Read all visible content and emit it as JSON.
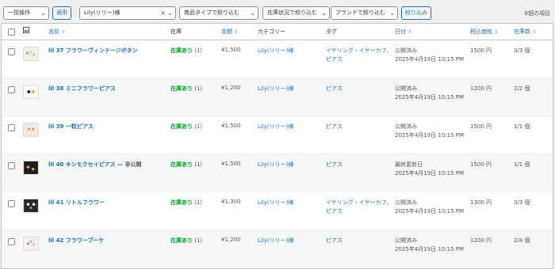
{
  "filters": {
    "bulk": "一括操作",
    "apply": "適用",
    "category": "Lily(リリー)様",
    "type": "商品タイプで絞り込む",
    "stock": "在庫状況で絞り込む",
    "brand": "ブランドで絞り込む",
    "submit": "絞り込み",
    "count": "8個の項目"
  },
  "columns": {
    "name": "名前",
    "stock": "在庫",
    "price": "金額",
    "category": "カテゴリー",
    "tag": "タグ",
    "date": "日付",
    "tax_price": "税込価格",
    "qty": "在庫数"
  },
  "rows": [
    {
      "name": "lil 37 フラワーヴィンテージボタン",
      "suffix": "",
      "stock": "在庫あり",
      "stock_n": "(1)",
      "price": "¥1,500",
      "category": "Lily(リリー)様",
      "tag1": "イヤリング・イヤーカフ,",
      "tag2": "ピアス",
      "status": "公開済み",
      "date": "2025年4月19日 10:15 PM",
      "tax": "1500 円",
      "qty": "3/3 個"
    },
    {
      "name": "lil 38 ミニフラワーピアス",
      "suffix": "",
      "stock": "在庫あり",
      "stock_n": "(1)",
      "price": "¥1,200",
      "category": "Lily(リリー)様",
      "tag1": "ピアス",
      "tag2": "",
      "status": "公開済み",
      "date": "2025年4月19日 10:15 PM",
      "tax": "1200 円",
      "qty": "2/2 個"
    },
    {
      "name": "lil 39 一粒ピアス",
      "suffix": "",
      "stock": "在庫あり",
      "stock_n": "(1)",
      "price": "¥1,500",
      "category": "Lily(リリー)様",
      "tag1": "ピアス",
      "tag2": "",
      "status": "公開済み",
      "date": "2025年4月19日 10:15 PM",
      "tax": "1500 円",
      "qty": "1/1 個"
    },
    {
      "name": "lil 40 キンモクセイピアス",
      "suffix": " — 非公開",
      "stock": "在庫あり",
      "stock_n": "(1)",
      "price": "¥1,500",
      "category": "Lily(リリー)様",
      "tag1": "ピアス",
      "tag2": "",
      "status": "最終更新日",
      "date": "2025年4月19日 10:15 PM",
      "tax": "1500 円",
      "qty": "1/1 個"
    },
    {
      "name": "lil 41 リトルフラワー",
      "suffix": "",
      "stock": "在庫あり",
      "stock_n": "(1)",
      "price": "¥1,300",
      "category": "Lily(リリー)様",
      "tag1": "イヤリング・イヤーカフ,",
      "tag2": "ピアス",
      "status": "公開済み",
      "date": "2025年4月19日 10:15 PM",
      "tax": "1300 円",
      "qty": "3/3 個"
    },
    {
      "name": "lil 42 フラワーブーケ",
      "suffix": "",
      "stock": "在庫あり",
      "stock_n": "(1)",
      "price": "¥1,200",
      "category": "Lily(リリー)様",
      "tag1": "ピアス",
      "tag2": "",
      "status": "公開済み",
      "date": "2025年4月19日 10:15 PM",
      "tax": "1200 円",
      "qty": "2/4 個"
    }
  ],
  "colors": {
    "link": "#2271b1",
    "in_stock": "#00a32a",
    "border": "#c3c4c7"
  },
  "icons": {
    "select": "chevron-down-icon",
    "clear": "close-icon",
    "sort": "sort-icon",
    "image_col": "image-icon"
  }
}
